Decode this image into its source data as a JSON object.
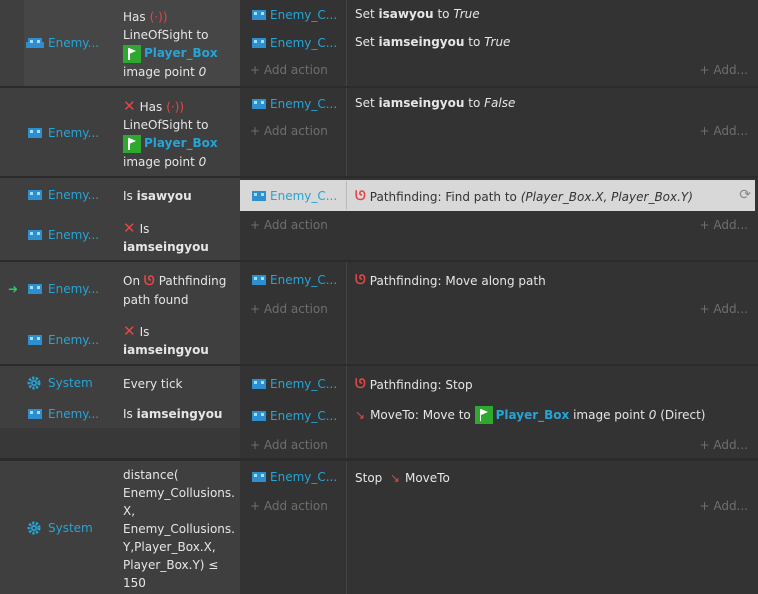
{
  "enemy_name": "Enemy...",
  "enemy_action_name": "Enemy_C...",
  "system_name": "System",
  "add_action": "+ Add action",
  "add_right": "+ Add...",
  "ev1": {
    "has": "Has",
    "los": "LineOfSight to",
    "pb": "Player_Box",
    "image_point": "image point",
    "point_num": "0",
    "act1_set": "Set",
    "act1_var": "isawyou",
    "act1_to": "to",
    "act1_val": "True",
    "act2_set": "Set",
    "act2_var": "iamseingyou",
    "act2_to": "to",
    "act2_val": "True"
  },
  "ev2": {
    "has": "Has",
    "los": "LineOfSight to",
    "pb": "Player_Box",
    "image_point": "image point",
    "point_num": "0",
    "act_set": "Set",
    "act_var": "iamseingyou",
    "act_to": "to",
    "act_val": "False"
  },
  "ev3": {
    "is": "Is",
    "var1": "isawyou",
    "is2": "Is",
    "var2": "iamseingyou",
    "act": "Pathfinding: Find path to",
    "act_arg": "(Player_Box.X, Player_Box.Y)"
  },
  "ev4": {
    "on": "On",
    "pf": "Pathfinding",
    "path_found": "path found",
    "is": "Is",
    "var": "iamseingyou",
    "act": "Pathfinding: Move along path"
  },
  "ev5": {
    "every_tick": "Every tick",
    "is": "Is",
    "var": "iamseingyou",
    "act1": "Pathfinding: Stop",
    "act2_pre": "MoveTo: Move to",
    "act2_pb": "Player_Box",
    "act2_ip": "image point",
    "act2_num": "0",
    "act2_post": "(Direct)"
  },
  "ev6": {
    "cond_lines": [
      "distance(",
      "Enemy_Collusions.",
      "X,",
      "Enemy_Collusions.",
      "Y,Player_Box.X,",
      "Player_Box.Y) ≤",
      "150"
    ],
    "act_stop": "Stop",
    "act_moveto": "MoveTo"
  }
}
